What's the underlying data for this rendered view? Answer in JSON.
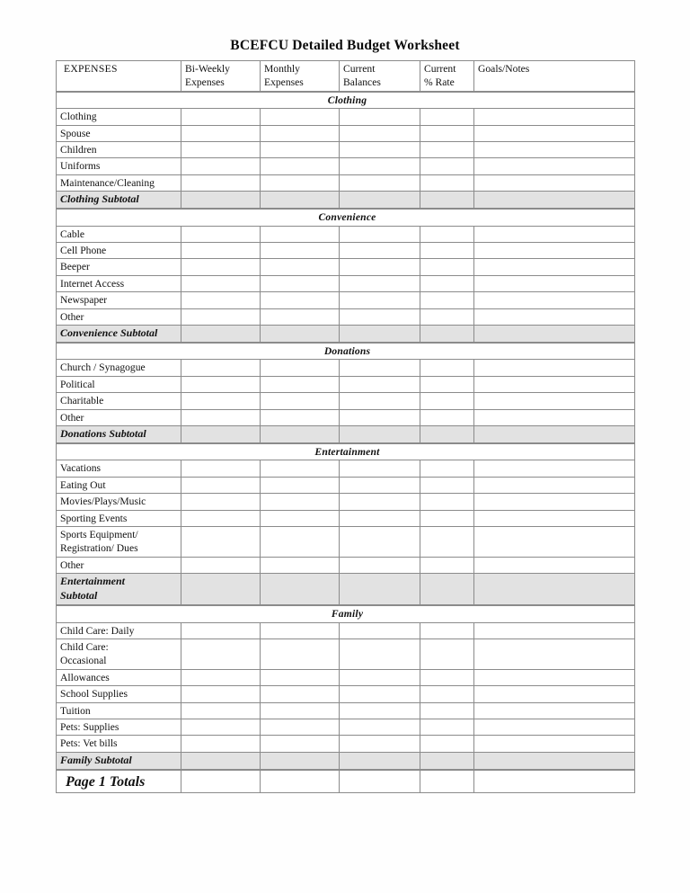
{
  "document": {
    "title": "BCEFCU Detailed Budget Worksheet"
  },
  "header": {
    "expenses_label": "EXPENSES",
    "columns": [
      {
        "line1": "Bi-Weekly",
        "line2": "Expenses"
      },
      {
        "line1": "Monthly",
        "line2": "Expenses"
      },
      {
        "line1": "Current",
        "line2": "Balances"
      },
      {
        "line1": "Current",
        "line2": "% Rate"
      },
      {
        "line1": "Goals/Notes",
        "line2": ""
      }
    ]
  },
  "sections": [
    {
      "title": "Clothing",
      "rows": [
        "Clothing",
        "Spouse",
        "Children",
        "Uniforms",
        "Maintenance/Cleaning"
      ],
      "subtotal": "Clothing Subtotal"
    },
    {
      "title": "Convenience",
      "rows": [
        "Cable",
        "Cell Phone",
        "Beeper",
        "Internet Access",
        "Newspaper",
        "Other"
      ],
      "subtotal": "Convenience Subtotal"
    },
    {
      "title": "Donations",
      "rows": [
        "Church / Synagogue",
        "Political",
        "Charitable",
        "Other"
      ],
      "subtotal": "Donations Subtotal"
    },
    {
      "title": "Entertainment",
      "rows": [
        "Vacations",
        "Eating Out",
        "Movies/Plays/Music",
        "Sporting Events",
        "Sports Equipment/\nRegistration/ Dues",
        "Other"
      ],
      "subtotal": "Entertainment\nSubtotal"
    },
    {
      "title": "Family",
      "rows": [
        "Child Care: Daily",
        "Child Care:\nOccasional",
        "Allowances",
        "School Supplies",
        "Tuition",
        "Pets: Supplies",
        "Pets: Vet bills"
      ],
      "subtotal": "Family Subtotal"
    }
  ],
  "totals": {
    "label": "Page 1 Totals"
  },
  "colors": {
    "subtotal_fill": "#e2e2e2",
    "totals_fill": "#d2d2d2",
    "border": "#8b8b8b",
    "text": "#111111"
  }
}
